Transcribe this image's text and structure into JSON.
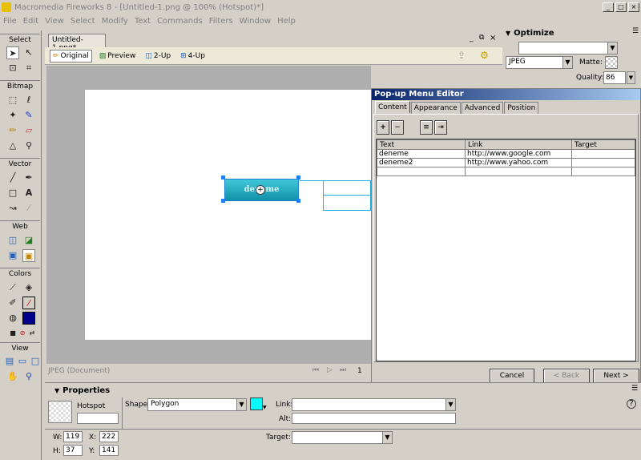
{
  "app": {
    "title": "Macromedia Fireworks 8 - [Untitled-1.png @ 100% (Hotspot)*]"
  },
  "menu": [
    "File",
    "Edit",
    "View",
    "Select",
    "Modify",
    "Text",
    "Commands",
    "Filters",
    "Window",
    "Help"
  ],
  "tools": {
    "sections": [
      "Select",
      "Bitmap",
      "Vector",
      "Web",
      "Colors",
      "View"
    ]
  },
  "document": {
    "tab": "Untitled-1.png*",
    "views": [
      "Original",
      "Preview",
      "2-Up",
      "4-Up"
    ],
    "button_text": "deneme",
    "status": "JPEG (Document)",
    "page": "1"
  },
  "optimize": {
    "title": "Optimize",
    "format": "JPEG",
    "matte_label": "Matte:",
    "quality_label": "Quality:",
    "quality": "86"
  },
  "popup_editor": {
    "title": "Pop-up Menu Editor",
    "tabs": [
      "Content",
      "Appearance",
      "Advanced",
      "Position"
    ],
    "columns": [
      "Text",
      "Link",
      "Target"
    ],
    "rows": [
      {
        "text": "deneme",
        "link": "http://www.google.com",
        "target": ""
      },
      {
        "text": "deneme2",
        "link": "http://www.yahoo.com",
        "target": ""
      }
    ],
    "buttons": {
      "cancel": "Cancel",
      "back": "< Back",
      "next": "Next >"
    }
  },
  "properties": {
    "title": "Properties",
    "object_type": "Hotspot",
    "shape_label": "Shape:",
    "shape": "Polygon",
    "link_label": "Link:",
    "alt_label": "Alt:",
    "target_label": "Target:",
    "w_label": "W:",
    "w": "119",
    "h_label": "H:",
    "h": "37",
    "x_label": "X:",
    "x": "222",
    "y_label": "Y:",
    "y": "141",
    "hotspot_color": "#00ffff"
  }
}
